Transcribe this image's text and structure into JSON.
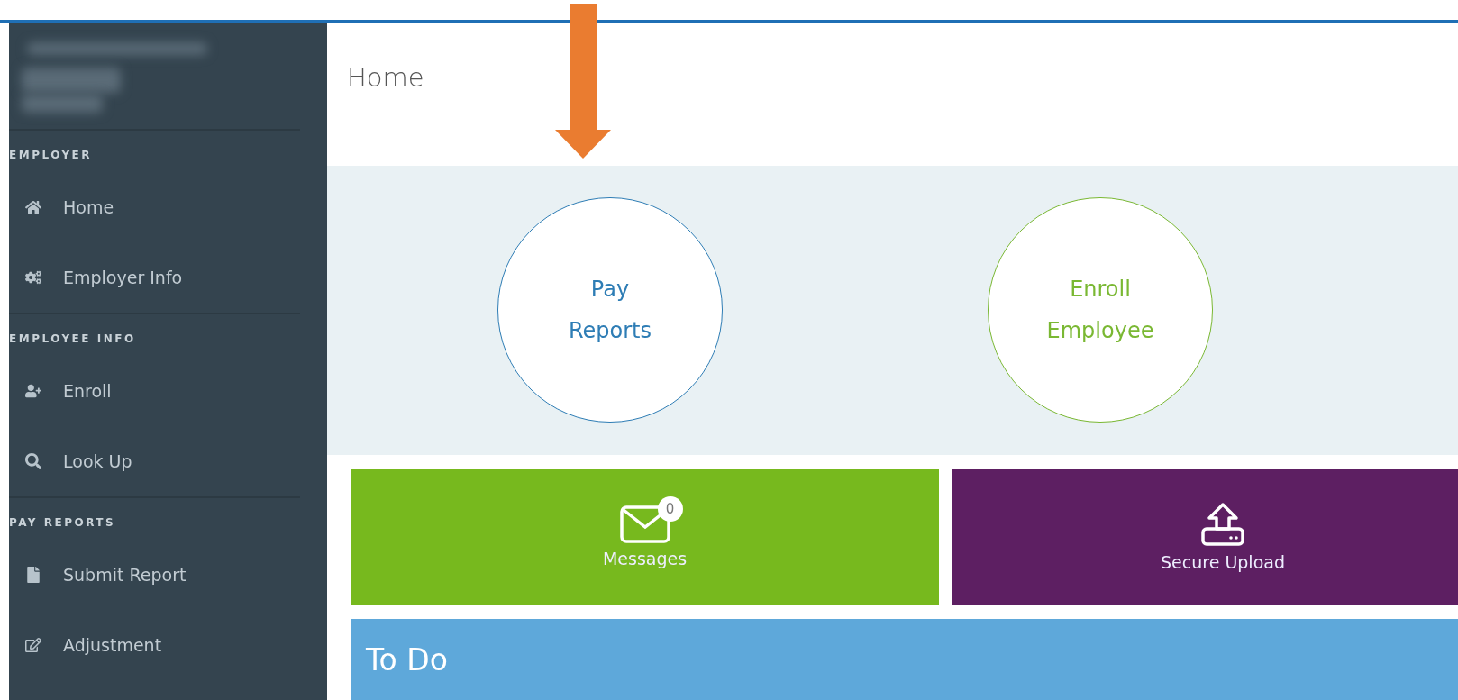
{
  "sidebar": {
    "sections": [
      {
        "heading": "EMPLOYER",
        "items": [
          {
            "kind": "home",
            "label": "Home"
          },
          {
            "kind": "gears",
            "label": "Employer Info"
          }
        ]
      },
      {
        "heading": "EMPLOYEE INFO",
        "items": [
          {
            "kind": "add-user",
            "label": "Enroll"
          },
          {
            "kind": "search",
            "label": "Look Up"
          }
        ]
      },
      {
        "heading": "PAY REPORTS",
        "items": [
          {
            "kind": "file",
            "label": "Submit Report"
          },
          {
            "kind": "edit-file",
            "label": "Adjustment"
          }
        ]
      }
    ]
  },
  "page": {
    "title": "Home"
  },
  "circles": [
    {
      "label": "Pay Reports",
      "color": "#2e7db5"
    },
    {
      "label": "Enroll Employee",
      "color": "#7ab833"
    }
  ],
  "tiles": [
    {
      "kind": "messages",
      "label": "Messages",
      "count": "0",
      "color": "#77b91e"
    },
    {
      "kind": "upload",
      "label": "Secure Upload",
      "color": "#5d1f62"
    }
  ],
  "todo": {
    "title": "To Do"
  }
}
